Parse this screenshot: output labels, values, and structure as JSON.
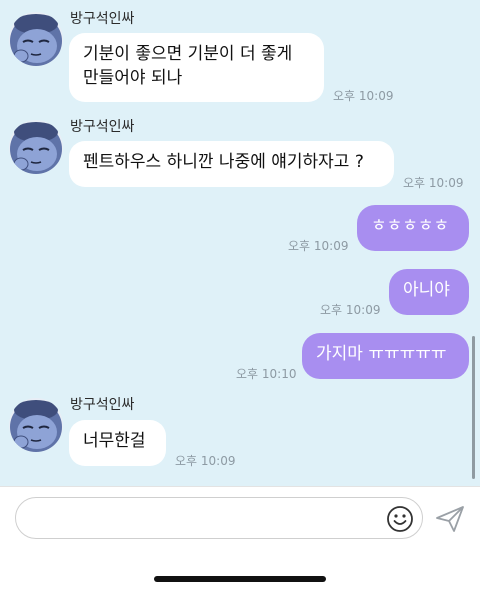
{
  "chat": {
    "messages": [
      {
        "sender": "방구석인싸",
        "lines": [
          "기분이 좋으면 기분이 더 좋게",
          "만들어야 되나"
        ],
        "time": "오후 10:09"
      },
      {
        "sender": "방구석인싸",
        "text": "펜트하우스 하니깐 나중에 얘기하자고 ?",
        "time": "오후 10:09"
      },
      {
        "text": "ㅎㅎㅎㅎㅎ",
        "time": "오후 10:09"
      },
      {
        "text": "아니야",
        "time": "오후 10:09"
      },
      {
        "text": "가지마 ㅠㅠㅠㅠㅠ",
        "time": "오후 10:10"
      },
      {
        "sender": "방구석인싸",
        "text": "너무한걸",
        "time": "오후 10:09"
      }
    ]
  },
  "input": {
    "placeholder": ""
  },
  "icons": {
    "emoji": "smiley-icon",
    "send": "send-arrow-icon",
    "avatar": "sleepy-character-avatar"
  },
  "colors": {
    "chat_background": "#dff1f8",
    "outgoing_bubble": "#a88ef0",
    "incoming_bubble": "#ffffff"
  }
}
